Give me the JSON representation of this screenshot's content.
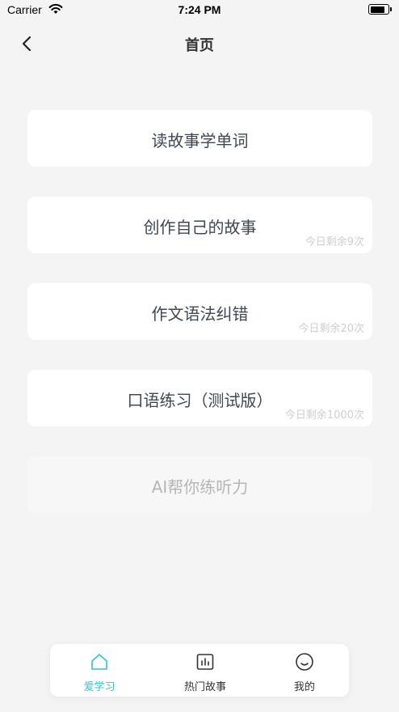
{
  "status_bar": {
    "carrier": "Carrier",
    "time": "7:24 PM"
  },
  "nav": {
    "title": "首页"
  },
  "menu": [
    {
      "label": "读故事学单词",
      "quota": ""
    },
    {
      "label": "创作自己的故事",
      "quota": "今日剩余9次"
    },
    {
      "label": "作文语法纠错",
      "quota": "今日剩余20次"
    },
    {
      "label": "口语练习（测试版）",
      "quota": "今日剩余1000次"
    },
    {
      "label": "AI帮你练听力",
      "quota": ""
    }
  ],
  "tabs": [
    {
      "label": "爱学习",
      "icon": "home-icon",
      "active": true
    },
    {
      "label": "热门故事",
      "icon": "chart-icon",
      "active": false
    },
    {
      "label": "我的",
      "icon": "smiley-icon",
      "active": false
    }
  ],
  "colors": {
    "accent": "#2ec5d3",
    "background": "#f4f4f4",
    "card": "#ffffff"
  }
}
